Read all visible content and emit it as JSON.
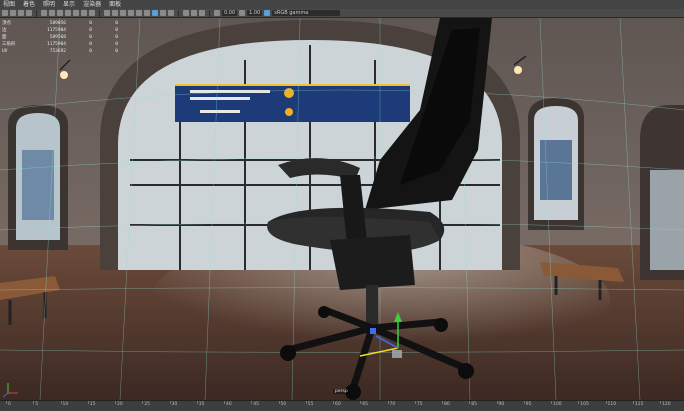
{
  "menu": [
    "视图",
    "着色",
    "照明",
    "显示",
    "渲染器",
    "面板"
  ],
  "toolbar": {
    "value_a": "0.00",
    "value_b": "1.00",
    "color_space": "sRGB gamma"
  },
  "hud": {
    "rows": [
      {
        "label": "顶点",
        "c1": "589056",
        "c2": "0",
        "c3": "0"
      },
      {
        "label": "边",
        "c1": "1175904",
        "c2": "0",
        "c3": "0"
      },
      {
        "label": "面",
        "c1": "589568",
        "c2": "0",
        "c3": "0"
      },
      {
        "label": "三角形",
        "c1": "1175904",
        "c2": "0",
        "c3": "0"
      },
      {
        "label": "UV",
        "c1": "753692",
        "c2": "0",
        "c3": "0"
      }
    ]
  },
  "camera_label": "persp",
  "timeline": {
    "ticks": [
      "0",
      "5",
      "10",
      "15",
      "20",
      "25",
      "30",
      "35",
      "40",
      "45",
      "50",
      "55",
      "60",
      "65",
      "70",
      "75",
      "80",
      "85",
      "90",
      "95",
      "100",
      "105",
      "110",
      "115",
      "120"
    ]
  },
  "colors": {
    "menubar": "#444444",
    "toolbar": "#4a4a4a",
    "accent": "#5aa0d8",
    "grid": "#8fe2d4"
  }
}
